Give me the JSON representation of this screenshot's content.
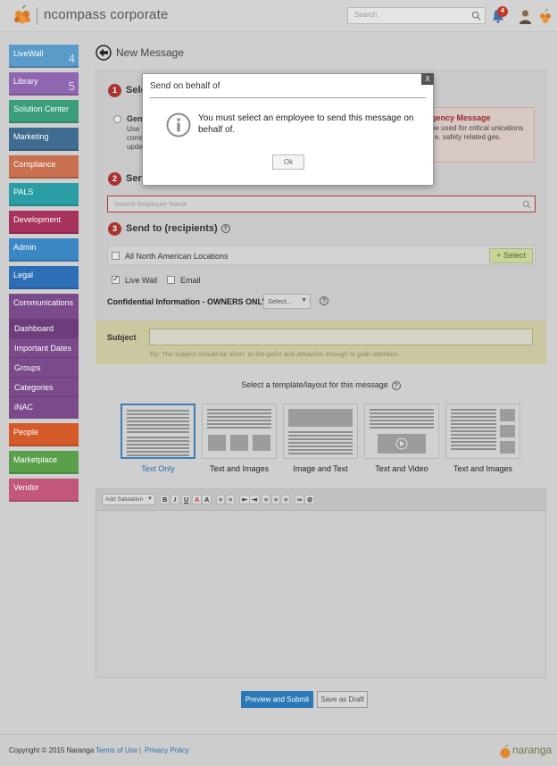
{
  "header": {
    "brand": "ncompass corporate",
    "search_placeholder": "Search",
    "notification_count": "4"
  },
  "sidebar": {
    "items": [
      {
        "label": "LiveWall",
        "count": "4",
        "color": "#5a9bc9"
      },
      {
        "label": "Library",
        "count": "5",
        "color": "#8f67b0"
      },
      {
        "label": "Solution Center",
        "color": "#3a9e7b"
      },
      {
        "label": "Marketing",
        "color": "#3e6b8f"
      },
      {
        "label": "Compliance",
        "color": "#c8704f"
      },
      {
        "label": "PALS",
        "color": "#2a9ea4"
      },
      {
        "label": "Development",
        "color": "#a8325e"
      },
      {
        "label": "Admin",
        "color": "#3a87c4"
      },
      {
        "label": "Legal",
        "color": "#2d6fb7"
      },
      {
        "label": "Communications",
        "color": "#7a4a8a"
      }
    ],
    "sub_items": [
      "Dashboard",
      "Important Dates",
      "Groups",
      "Categories",
      "iNAC"
    ],
    "items_after": [
      {
        "label": "People",
        "color": "#d45a2a"
      },
      {
        "label": "Marketplace",
        "color": "#5aa04a"
      },
      {
        "label": "Vendor",
        "color": "#c35779"
      }
    ]
  },
  "main": {
    "title": "New Message",
    "step1": {
      "num": "1",
      "label": "Sele"
    },
    "general_label": "Gene",
    "general_desc": [
      "Use th",
      "comm",
      "upda"
    ],
    "urgent": {
      "title": "gency Message",
      "desc": "be used for critical unications i.e. safety related ges."
    },
    "step2": {
      "num": "2",
      "label": "Sen"
    },
    "employee_placeholder": "Search Employee Name",
    "step3": {
      "num": "3",
      "label": "Send to (recipients)"
    },
    "help_glyph": "?",
    "recipients_label": "All North American Locations",
    "select_button": "+ Select",
    "livewall_label": "Live Wall",
    "email_label": "Email",
    "confidential_label": "Confidential Information - OWNERS ONLY",
    "confidential_select": "Select...",
    "subject_label": "Subject",
    "subject_tip": "Tip: The subject should be short, to-the-point and attractive enough to grab attention.",
    "template_heading": "Select a template/layout for this message",
    "templates": [
      "Text Only",
      "Text and Images",
      "Image and Text",
      "Text and Video",
      "Text and Images"
    ],
    "toolbar": {
      "salutation": "Add Salutation",
      "bold": "B",
      "italic": "I",
      "underline": "U"
    },
    "preview_button": "Preview and Submit",
    "draft_button": "Save as Draft"
  },
  "footer": {
    "copyright": "Copyright © 2015 Naranga",
    "terms": "Terms of Use",
    "separator": "|",
    "privacy": "Privacy Policy",
    "brand": "naranga"
  },
  "modal": {
    "title": "Send on behalf of",
    "close": "X",
    "message": "You must select an employee to send this message on behalf of.",
    "ok": "Ok"
  }
}
